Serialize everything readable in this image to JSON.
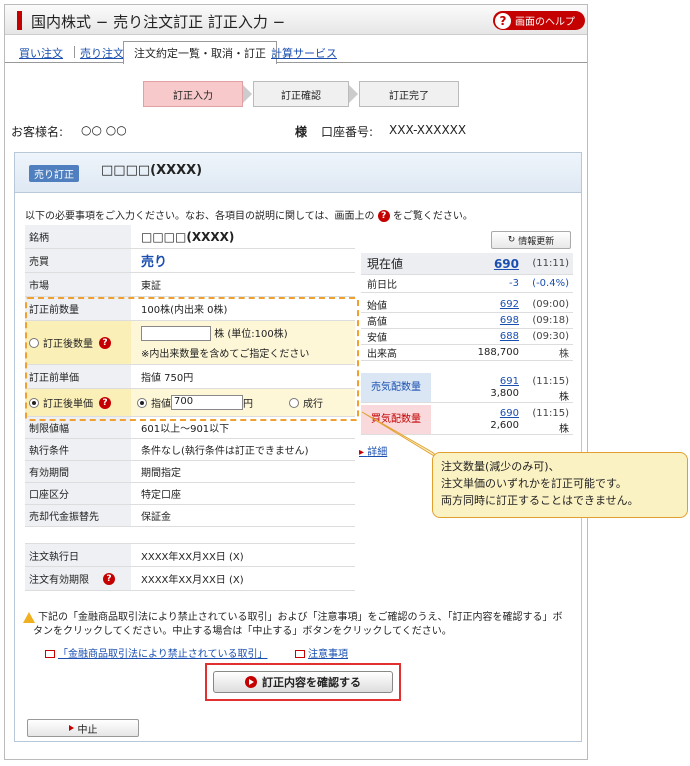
{
  "header": {
    "title": "国内株式 − 売り注文訂正 訂正入力 −",
    "help_label": "画面のヘルプ",
    "help_q": "?"
  },
  "tabs": {
    "buy": "買い注文",
    "sell": "売り注文",
    "orders": "注文約定一覧・取消・訂正",
    "simulation": "計算サービス"
  },
  "steps": [
    "訂正入力",
    "訂正確認",
    "訂正完了"
  ],
  "customer": {
    "label": "お客様名:",
    "name": "○○ ○○",
    "honorific": "様",
    "account_label": "口座番号:",
    "account_no": "XXX-XXXXXX"
  },
  "panel": {
    "badge": "売り訂正",
    "stock_name": "□□□□(XXXX)",
    "intro": "以下の必要事項をご入力ください。なお、各項目の説明に関しては、画面上の",
    "intro_tail": "をご覧ください。",
    "q": "?"
  },
  "form": {
    "stock_label": "銘柄",
    "stock_value": "□□□□(XXXX)",
    "side_label": "売買",
    "side_value": "売り",
    "market_label": "市場",
    "market_value": "東証",
    "pre_qty_label": "訂正前数量",
    "pre_qty_value": "100株(内出来 0株)",
    "post_qty_label": "訂正後数量",
    "post_qty_unit": "株 (単位:100株)",
    "post_qty_note": "※内出来数量を含めてご指定ください",
    "pre_price_label": "訂正前単価",
    "pre_price_value": "指値 750円",
    "post_price_label": "訂正後単価",
    "limit_label": "指値",
    "limit_value": "700",
    "limit_unit": "円",
    "market_order_label": "成行",
    "limit_range_label": "制限値幅",
    "limit_range_value": "601以上〜901以下",
    "exec_cond_label": "執行条件",
    "exec_cond_value": "条件なし(執行条件は訂正できません)",
    "period_label": "有効期間",
    "period_value": "期間指定",
    "account_type_label": "口座区分",
    "account_type_value": "特定口座",
    "transfer_label": "売却代金振替先",
    "transfer_value": "保証金",
    "exec_date_label": "注文執行日",
    "exec_date_value": "XXXX年XX月XX日 (X)",
    "expiry_label": "注文有効期限",
    "expiry_value": "XXXX年XX月XX日 (X)"
  },
  "quote": {
    "refresh_label": "情報更新",
    "price_label": "現在値",
    "price_value": "690",
    "price_time": "(11:11)",
    "change_label": "前日比",
    "change_value": "-3",
    "change_pct": "(-0.4%)",
    "open_label": "始値",
    "open_value": "692",
    "open_time": "(09:00)",
    "high_label": "高値",
    "high_value": "698",
    "high_time": "(09:18)",
    "low_label": "安値",
    "low_value": "688",
    "low_time": "(09:30)",
    "volume_label": "出来高",
    "volume_value": "188,700",
    "volume_unit": "株",
    "ask_label": "売気配数量",
    "ask_price": "691",
    "ask_time": "(11:15)",
    "ask_qty": "3,800",
    "ask_unit": "株",
    "bid_label": "買気配数量",
    "bid_price": "690",
    "bid_time": "(11:15)",
    "bid_qty": "2,600",
    "bid_unit": "株",
    "detail_link": "詳細"
  },
  "callout": {
    "line1": "注文数量(減少のみ可)、",
    "line2": "注文単価のいずれかを訂正可能です。",
    "line3": "両方同時に訂正することはできません。"
  },
  "notice": {
    "text1": "下記の「金融商品取引法により禁止されている取引」および「注意事項」をご確認のうえ、「訂正内容を確認する」ボ",
    "text2": "タンをクリックしてください。中止する場合は「中止する」ボタンをクリックしてください。",
    "link1": "「金融商品取引法により禁止されている取引」",
    "link2": "注意事項"
  },
  "buttons": {
    "confirm": "訂正内容を確認する",
    "cancel": "中止"
  },
  "colors": {
    "brand_red": "#c40000",
    "link_blue": "#1a4fb0",
    "highlight_orange": "#f0a030"
  }
}
